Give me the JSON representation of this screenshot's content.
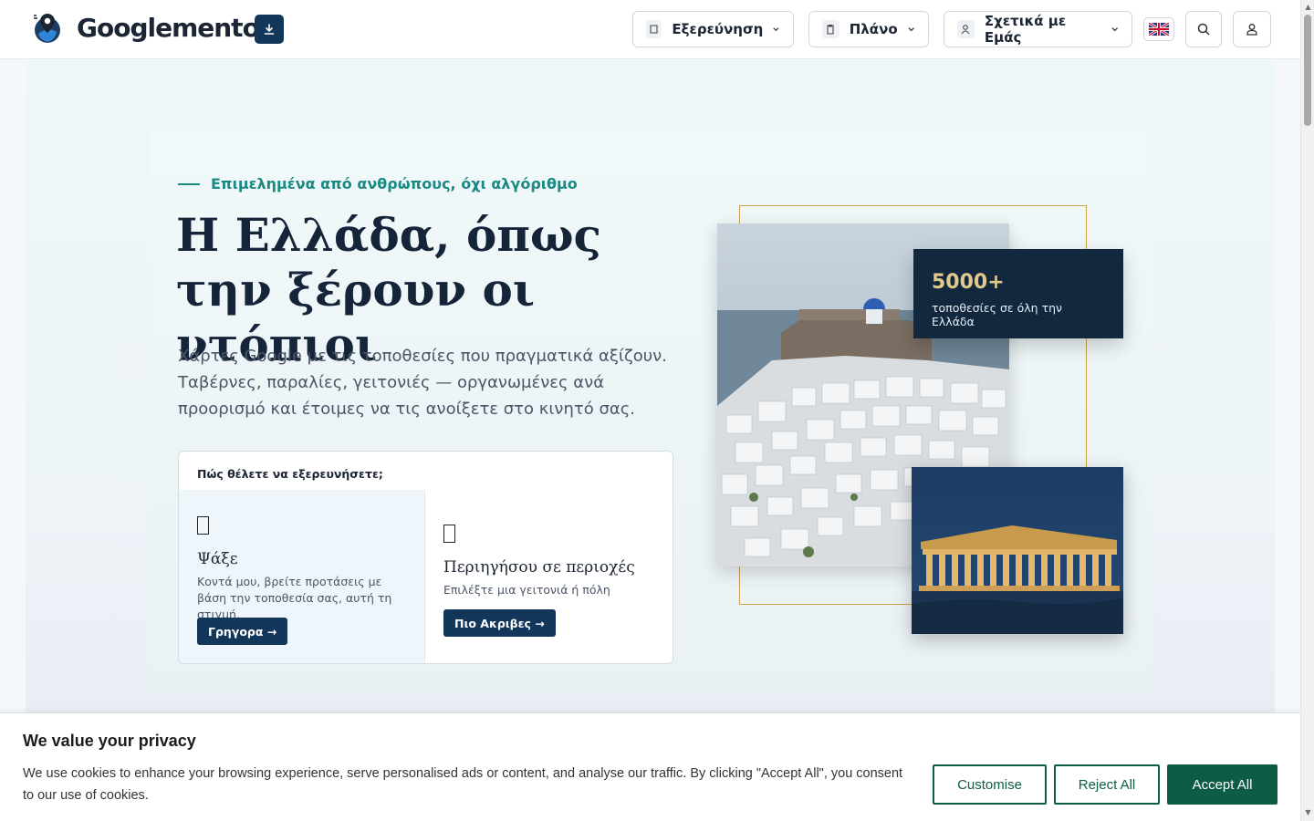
{
  "header": {
    "logo_text": "Googlementor",
    "nav": [
      {
        "label": "Εξερεύνηση",
        "icon": "book-icon"
      },
      {
        "label": "Πλάνο",
        "icon": "clipboard-icon"
      },
      {
        "label": "Σχετικά με Εμάς",
        "icon": "person-icon"
      }
    ],
    "language_flag": "uk-flag-icon"
  },
  "hero": {
    "eyebrow": "Επιμελημένα από ανθρώπους, όχι αλγόριθμο",
    "title": "Η Ελλάδα, όπως την ξέρουν οι ντόπιοι",
    "subtitle": "Χάρτες Google με τις τοποθεσίες που πραγματικά αξίζουν. Ταβέρνες, παραλίες, γειτονιές — οργανωμένες ανά προορισμό και έτοιμες να τις ανοίξετε στο κινητό σας.",
    "explore_card": {
      "heading": "Πώς θέλετε να εξερευνήσετε;",
      "options": [
        {
          "title": "Ψάξε",
          "description": "Κοντά μου, βρείτε προτάσεις με βάση την τοποθεσία σας, αυτή τη στιγμή.",
          "button": "Γρηγορα →"
        },
        {
          "title": "Περιηγήσου σε περιοχές",
          "description": "Επιλέξτε μια γειτονιά ή πόλη",
          "button": "Πιο Ακριβες →"
        }
      ]
    },
    "stat": {
      "number": "5000+",
      "label": "τοποθεσίες σε όλη την Ελλάδα"
    }
  },
  "cookie": {
    "title": "We value your privacy",
    "text": "We use cookies to enhance your browsing experience, serve personalised ads or content, and analyse our traffic. By clicking \"Accept All\", you consent to our use of cookies.",
    "customise": "Customise",
    "reject": "Reject All",
    "accept": "Accept All"
  },
  "colors": {
    "navy": "#12375a",
    "teal": "#1b8a84",
    "gold": "#c9a24a",
    "cookie_green": "#0d5c45"
  }
}
